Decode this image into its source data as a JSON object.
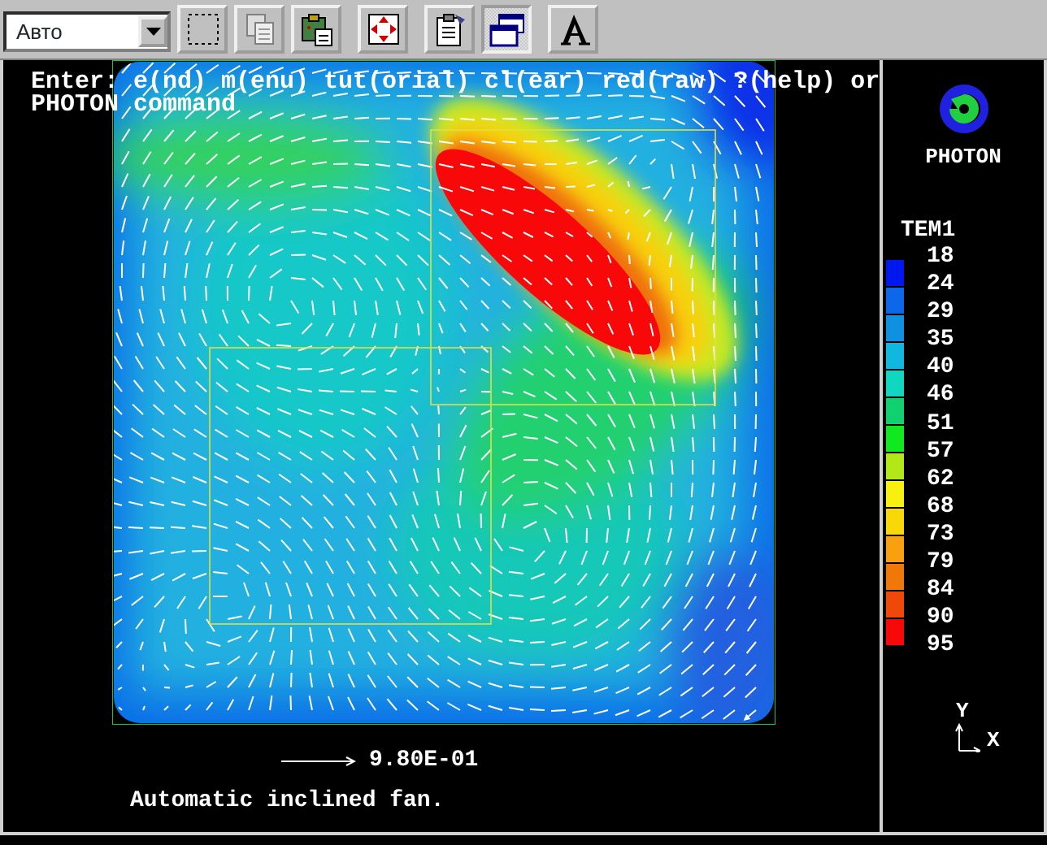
{
  "toolbar": {
    "dropdown": {
      "value": "Авто"
    },
    "buttons": [
      {
        "kind": "select",
        "selected": false
      },
      {
        "kind": "copy",
        "selected": false
      },
      {
        "kind": "paste",
        "selected": false
      },
      {
        "kind": "fit",
        "selected": false
      },
      {
        "kind": "properties",
        "selected": false
      },
      {
        "kind": "window",
        "selected": true
      },
      {
        "kind": "font",
        "selected": false
      }
    ]
  },
  "console": {
    "lines": [
      "Enter: e(nd) m(enu) tut(orial) cl(ear) red(raw) ?(help) or",
      "PHOTON command"
    ]
  },
  "plot": {
    "vector_scale": "9.80E-01",
    "caption": "Automatic inclined fan."
  },
  "logo": {
    "text": "PHOTON"
  },
  "legend": {
    "title": "TEM1",
    "labels": [
      "18",
      "24",
      "29",
      "35",
      "40",
      "46",
      "51",
      "57",
      "62",
      "68",
      "73",
      "79",
      "84",
      "90",
      "95"
    ],
    "bands": [
      {
        "color": "#0018f0"
      },
      {
        "color": "#0c68e8"
      },
      {
        "color": "#1090e0"
      },
      {
        "color": "#10b8e0"
      },
      {
        "color": "#10d8c0"
      },
      {
        "color": "#10d070"
      },
      {
        "color": "#10e820"
      },
      {
        "color": "#b0e818"
      },
      {
        "color": "#f8f010"
      },
      {
        "color": "#f8d808"
      },
      {
        "color": "#f8a010"
      },
      {
        "color": "#f07808"
      },
      {
        "color": "#f04808"
      },
      {
        "color": "#f80808"
      }
    ]
  },
  "axes": {
    "y_label": "Y",
    "x_label": "X"
  }
}
